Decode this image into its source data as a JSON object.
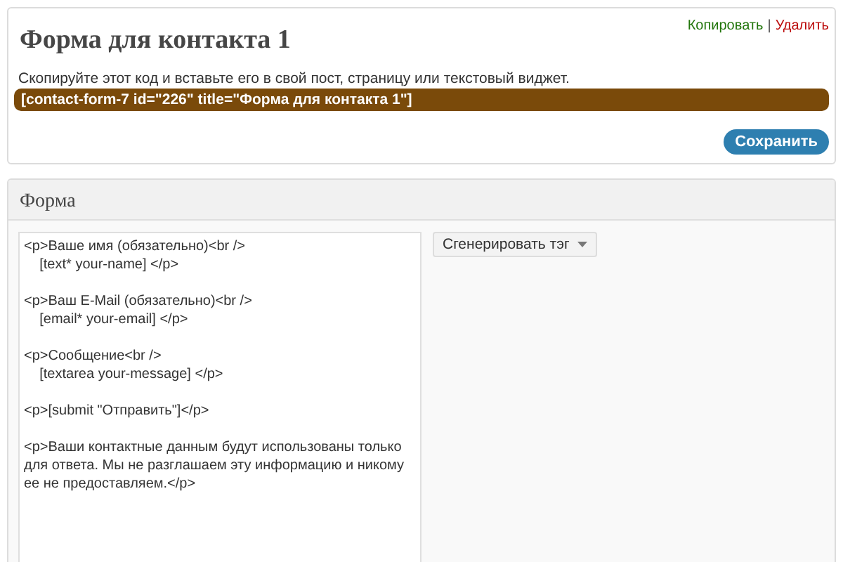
{
  "title": "Форма для контакта 1",
  "actions": [
    {
      "label": "Копировать",
      "kind": "copy"
    },
    {
      "label": "Удалить",
      "kind": "delete"
    }
  ],
  "separator": "|",
  "instruction": "Скопируйте этот код и вставьте его в свой пост, страницу или текстовый виджет.",
  "shortcode": "[contact-form-7 id=\"226\" title=\"Форма для контакта 1\"]",
  "save_button": "Сохранить",
  "form_panel": {
    "title": "Форма",
    "editor_value": "<p>Ваше имя (обязательно)<br />\n    [text* your-name] </p>\n\n<p>Ваш E-Mail (обязательно)<br />\n    [email* your-email] </p>\n\n<p>Сообщение<br />\n    [textarea your-message] </p>\n\n<p>[submit \"Отправить\"]</p>\n\n<p>Ваши контактные данным будут использованы только для ответа. Мы не разглашаем эту информацию и никому ее не предоставляем.</p>",
    "generate_button": "Сгенерировать тэг"
  }
}
